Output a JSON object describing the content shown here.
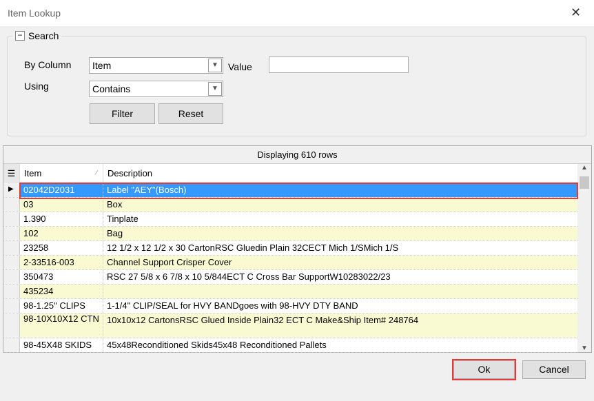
{
  "window": {
    "title": "Item Lookup",
    "close": "✕"
  },
  "search": {
    "group_label": "Search",
    "collapse": "−",
    "by_column_label": "By Column",
    "by_column_value": "Item",
    "value_label": "Value",
    "value": "",
    "using_label": "Using",
    "using_value": "Contains",
    "filter": "Filter",
    "reset": "Reset"
  },
  "grid": {
    "status": "Displaying 610 rows",
    "columns": [
      "Item",
      "Description"
    ],
    "rows": [
      {
        "item": "02042D2031",
        "desc": "Label \"AEY\"(Bosch)"
      },
      {
        "item": "03",
        "desc": "Box"
      },
      {
        "item": "1.390",
        "desc": "Tinplate"
      },
      {
        "item": "102",
        "desc": "Bag"
      },
      {
        "item": "23258",
        "desc": "12 1/2 x 12 1/2 x 30 CartonRSC Gluedin Plain 32CECT Mich 1/SMich 1/S"
      },
      {
        "item": "2-33516-003",
        "desc": "Channel Support Crisper Cover"
      },
      {
        "item": "350473",
        "desc": "RSC 27 5/8 x 6 7/8 x 10 5/844ECT C Cross Bar SupportW10283022/23"
      },
      {
        "item": "435234",
        "desc": ""
      },
      {
        "item": "98-1.25\" CLIPS",
        "desc": "1-1/4\" CLIP/SEAL for HVY BANDgoes with 98-HVY DTY BAND"
      },
      {
        "item": "98-10X10X12 CTN",
        "desc": "10x10x12 CartonsRSC Glued Inside Plain32 ECT C Make&Ship Item# 248764"
      },
      {
        "item": "98-45X48 SKIDS",
        "desc": "45x48Reconditioned Skids45x48 Reconditioned Pallets"
      }
    ]
  },
  "footer": {
    "ok": "Ok",
    "cancel": "Cancel"
  },
  "colors": {
    "selection": "#3399ff",
    "alt_row": "#fafad2",
    "highlight_border": "#e53935"
  }
}
